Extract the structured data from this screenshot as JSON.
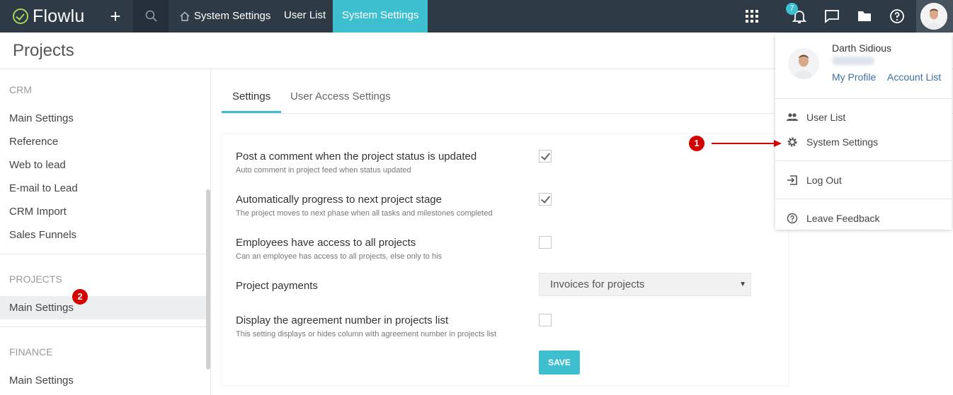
{
  "topbar": {
    "logo_text": "Flowlu",
    "plus_icon": "plus-icon",
    "search_icon": "search-icon",
    "tabs": [
      {
        "label": "System Settings",
        "icon": "home-icon"
      },
      {
        "label": "User List"
      },
      {
        "label": "System Settings",
        "active": true
      }
    ],
    "notification_count": "7",
    "icons": [
      "apps-grid-icon",
      "bell-icon",
      "chat-icon",
      "folder-icon",
      "help-icon"
    ]
  },
  "page": {
    "title": "Projects"
  },
  "sidebar": {
    "groups": [
      {
        "label": "CRM",
        "items": [
          "Main Settings",
          "Reference",
          "Web to lead",
          "E-mail to Lead",
          "CRM Import",
          "Sales Funnels"
        ]
      },
      {
        "label": "PROJECTS",
        "items": [
          "Main Settings"
        ]
      },
      {
        "label": "FINANCE",
        "items": [
          "Main Settings"
        ]
      }
    ]
  },
  "main": {
    "tabs": [
      {
        "label": "Settings",
        "active": true
      },
      {
        "label": "User Access Settings"
      }
    ],
    "settings": [
      {
        "title": "Post a comment when the project status is updated",
        "desc": "Auto comment in project feed when status updated",
        "checked": true
      },
      {
        "title": "Automatically progress to next project stage",
        "desc": "The project moves to next phase when all tasks and milestones completed",
        "checked": true
      },
      {
        "title": "Employees have access to all projects",
        "desc": "Can an employee has access to all projects, else only to his",
        "checked": false
      },
      {
        "title": "Project payments",
        "select_value": "Invoices for projects"
      },
      {
        "title": "Display the agreement number in projects list",
        "desc": "This setting displays or hides column with agreement number in projects list",
        "checked": false
      }
    ],
    "save_label": "SAVE"
  },
  "user_menu": {
    "name": "Darth Sidious",
    "links": [
      "My Profile",
      "Account List"
    ],
    "items": [
      {
        "label": "User List",
        "icon": "users-icon"
      },
      {
        "label": "System Settings",
        "icon": "gear-icon"
      },
      {
        "label": "Log Out",
        "icon": "logout-icon"
      },
      {
        "label": "Leave Feedback",
        "icon": "feedback-icon"
      }
    ]
  },
  "annotations": {
    "marker_1": "1",
    "marker_2": "2"
  },
  "colors": {
    "topbar": "#2e3a46",
    "accent": "#3ebfcf",
    "marker": "#d40000",
    "link": "#3a6ea5"
  }
}
